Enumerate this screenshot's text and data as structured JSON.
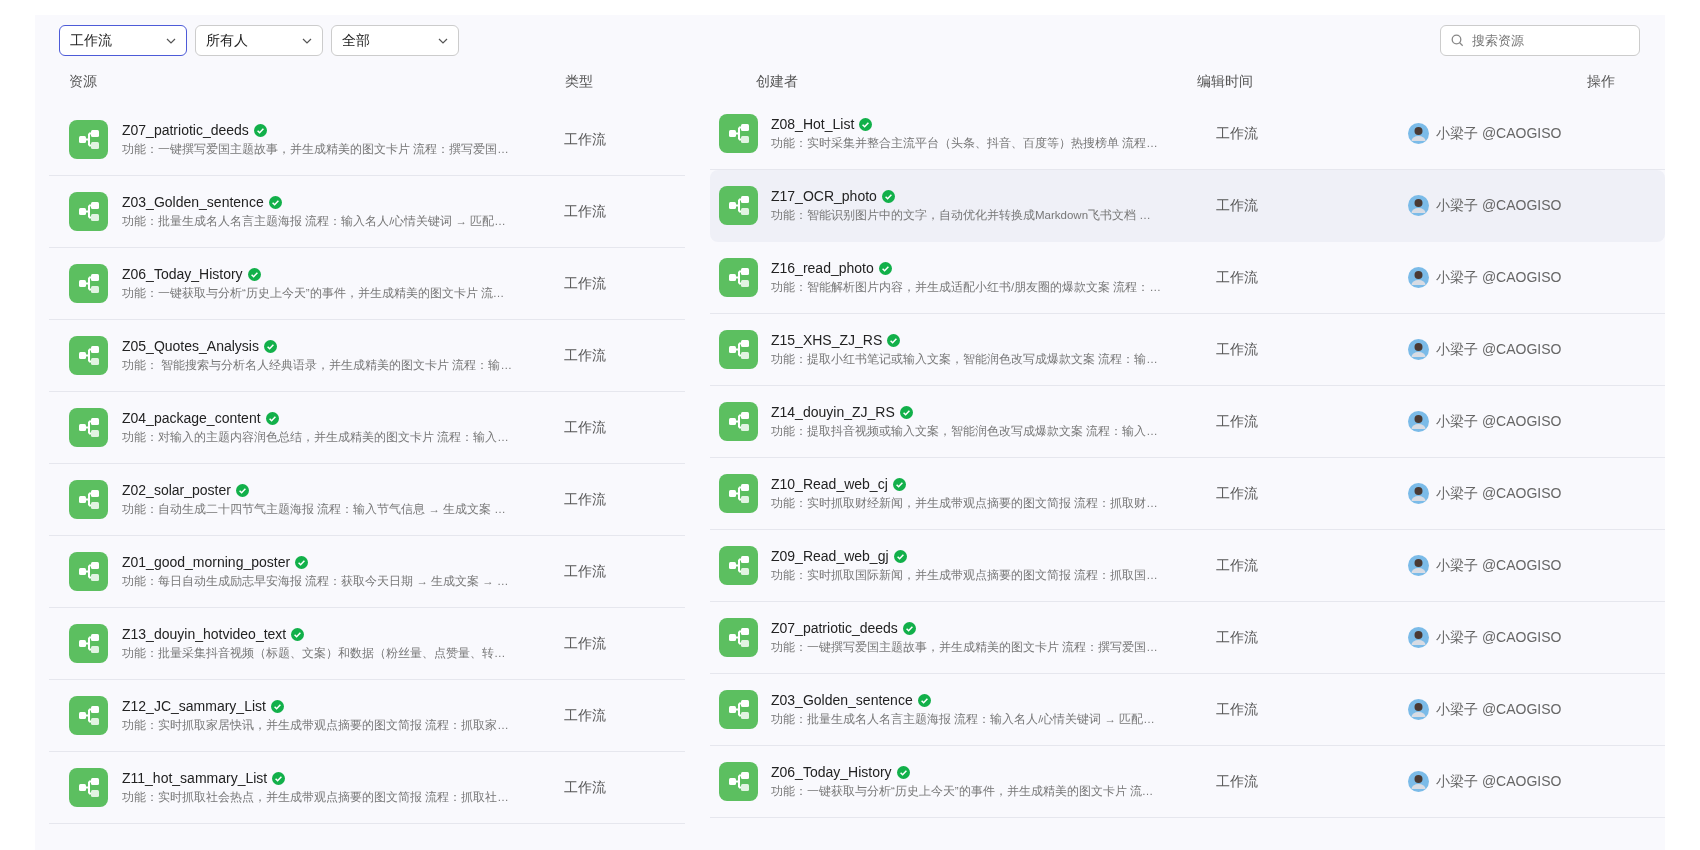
{
  "filters": [
    {
      "value": "工作流",
      "selected": true
    },
    {
      "value": "所有人",
      "selected": false
    },
    {
      "value": "全部",
      "selected": false
    }
  ],
  "search": {
    "placeholder": "搜索资源"
  },
  "table": {
    "columns": [
      "资源",
      "类型",
      "创建者",
      "编辑时间",
      "操作"
    ],
    "panels": [
      {
        "rows": [
          {
            "name": "Z07_patriotic_deeds",
            "verified": true,
            "description": "功能：一键撰写爱国主题故事，并生成精美的图文卡片 流程：撰写爱国…",
            "type": "工作流",
            "selected": false
          },
          {
            "name": "Z03_Golden_sentence",
            "verified": true,
            "description": "功能：批量生成名人名言主题海报 流程：输入名人/心情关键词 → 匹配…",
            "type": "工作流",
            "selected": false
          },
          {
            "name": "Z06_Today_History",
            "verified": true,
            "description": "功能：一键获取与分析“历史上今天”的事件，并生成精美的图文卡片 流…",
            "type": "工作流",
            "selected": false
          },
          {
            "name": "Z05_Quotes_Analysis",
            "verified": true,
            "description": "功能： 智能搜索与分析名人经典语录，并生成精美的图文卡片 流程：输…",
            "type": "工作流",
            "selected": false
          },
          {
            "name": "Z04_package_content",
            "verified": true,
            "description": "功能：对输入的主题内容润色总结，并生成精美的图文卡片 流程：输入…",
            "type": "工作流",
            "selected": false
          },
          {
            "name": "Z02_solar_poster",
            "verified": true,
            "description": "功能：自动生成二十四节气主题海报 流程：输入节气信息 → 生成文案 …",
            "type": "工作流",
            "selected": false
          },
          {
            "name": "Z01_good_morning_poster",
            "verified": true,
            "description": "功能：每日自动生成励志早安海报 流程：获取今天日期 → 生成文案 → …",
            "type": "工作流",
            "selected": false
          },
          {
            "name": "Z13_douyin_hotvideo_text",
            "verified": true,
            "description": "功能：批量采集抖音视频（标题、文案）和数据（粉丝量、点赞量、转…",
            "type": "工作流",
            "selected": false
          },
          {
            "name": "Z12_JC_sammary_List",
            "verified": true,
            "description": "功能：实时抓取家居快讯，并生成带观点摘要的图文简报 流程：抓取家…",
            "type": "工作流",
            "selected": false
          },
          {
            "name": "Z11_hot_sammary_List",
            "verified": true,
            "description": "功能：实时抓取社会热点，并生成带观点摘要的图文简报 流程：抓取社…",
            "type": "工作流",
            "selected": false
          }
        ]
      },
      {
        "rows": [
          {
            "name": "Z08_Hot_List",
            "verified": true,
            "description": "功能：实时采集并整合主流平台（头条、抖音、百度等）热搜榜单 流程…",
            "type": "工作流",
            "creator": "小梁子 @CAOGISO",
            "selected": false
          },
          {
            "name": "Z17_OCR_photo",
            "verified": true,
            "description": "功能：智能识别图片中的文字，自动优化并转换成Markdown飞书文档 …",
            "type": "工作流",
            "creator": "小梁子 @CAOGISO",
            "selected": true
          },
          {
            "name": "Z16_read_photo",
            "verified": true,
            "description": "功能：智能解析图片内容，并生成适配小红书/朋友圈的爆款文案 流程：…",
            "type": "工作流",
            "creator": "小梁子 @CAOGISO",
            "selected": false
          },
          {
            "name": "Z15_XHS_ZJ_RS",
            "verified": true,
            "description": "功能：提取小红书笔记或输入文案，智能润色改写成爆款文案 流程：输…",
            "type": "工作流",
            "creator": "小梁子 @CAOGISO",
            "selected": false
          },
          {
            "name": "Z14_douyin_ZJ_RS",
            "verified": true,
            "description": "功能：提取抖音视频或输入文案，智能润色改写成爆款文案 流程：输入…",
            "type": "工作流",
            "creator": "小梁子 @CAOGISO",
            "selected": false
          },
          {
            "name": "Z10_Read_web_cj",
            "verified": true,
            "description": "功能：实时抓取财经新闻，并生成带观点摘要的图文简报 流程：抓取财…",
            "type": "工作流",
            "creator": "小梁子 @CAOGISO",
            "selected": false
          },
          {
            "name": "Z09_Read_web_gj",
            "verified": true,
            "description": "功能：实时抓取国际新闻，并生成带观点摘要的图文简报 流程：抓取国…",
            "type": "工作流",
            "creator": "小梁子 @CAOGISO",
            "selected": false
          },
          {
            "name": "Z07_patriotic_deeds",
            "verified": true,
            "description": "功能：一键撰写爱国主题故事，并生成精美的图文卡片 流程：撰写爱国…",
            "type": "工作流",
            "creator": "小梁子 @CAOGISO",
            "selected": false
          },
          {
            "name": "Z03_Golden_sentence",
            "verified": true,
            "description": "功能：批量生成名人名言主题海报 流程：输入名人/心情关键词 → 匹配…",
            "type": "工作流",
            "creator": "小梁子 @CAOGISO",
            "selected": false
          },
          {
            "name": "Z06_Today_History",
            "verified": true,
            "description": "功能：一键获取与分析“历史上今天”的事件，并生成精美的图文卡片 流…",
            "type": "工作流",
            "creator": "小梁子 @CAOGISO",
            "selected": false
          }
        ]
      }
    ]
  }
}
